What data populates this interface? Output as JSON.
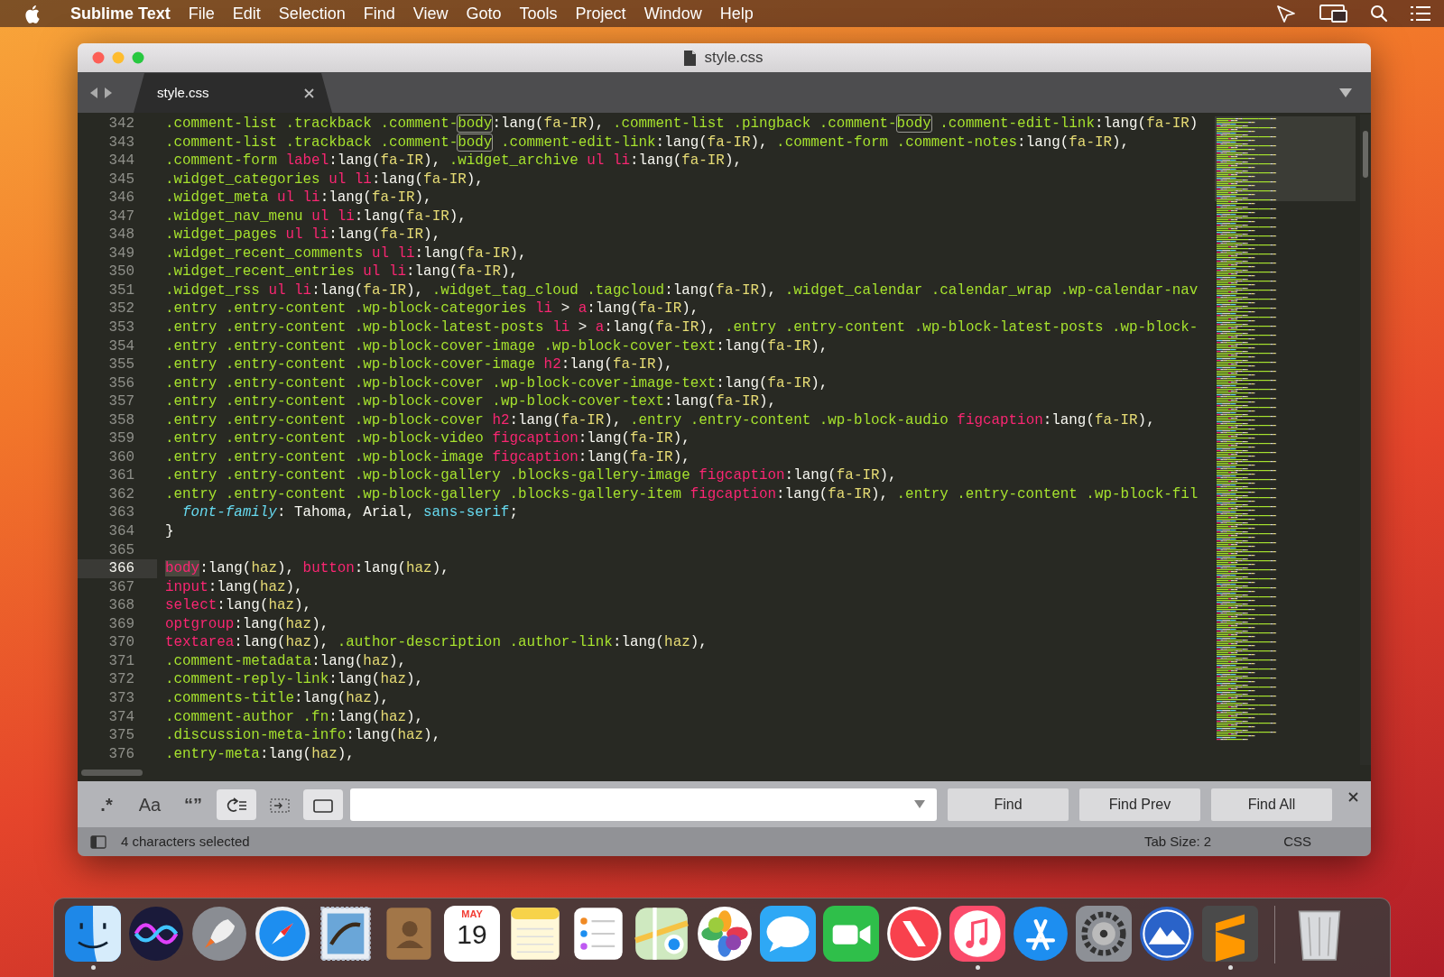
{
  "menu_bar": {
    "app": "Sublime Text",
    "items": [
      "File",
      "Edit",
      "Selection",
      "Find",
      "View",
      "Goto",
      "Tools",
      "Project",
      "Window",
      "Help"
    ]
  },
  "window": {
    "title": "style.css"
  },
  "tabs": [
    {
      "label": "style.css",
      "selected": true
    }
  ],
  "editor": {
    "lines": [
      {
        "number": "342",
        "current": false,
        "tokens": [
          {
            "kind": "selector",
            "text": ".comment-list .trackback .comment-"
          },
          {
            "kind": "match",
            "text": "body"
          },
          {
            "kind": "plain",
            "text": ":lang("
          },
          {
            "kind": "argument",
            "text": "fa-IR"
          },
          {
            "kind": "plain",
            "text": "), "
          },
          {
            "kind": "selector",
            "text": ".comment-list .pingback .comment-"
          },
          {
            "kind": "match",
            "text": "body"
          },
          {
            "kind": "selector",
            "text": " .comment-edit-link"
          },
          {
            "kind": "plain",
            "text": ":lang("
          },
          {
            "kind": "argument",
            "text": "fa-IR"
          },
          {
            "kind": "plain",
            "text": ")"
          }
        ]
      },
      {
        "number": "343",
        "current": false,
        "tokens": [
          {
            "kind": "selector",
            "text": ".comment-list .trackback .comment-"
          },
          {
            "kind": "match",
            "text": "body"
          },
          {
            "kind": "selector",
            "text": " .comment-edit-link"
          },
          {
            "kind": "plain",
            "text": ":lang("
          },
          {
            "kind": "argument",
            "text": "fa-IR"
          },
          {
            "kind": "plain",
            "text": "), "
          },
          {
            "kind": "selector",
            "text": ".comment-form .comment-notes"
          },
          {
            "kind": "plain",
            "text": ":lang("
          },
          {
            "kind": "argument",
            "text": "fa-IR"
          },
          {
            "kind": "plain",
            "text": "),"
          }
        ]
      },
      {
        "number": "344",
        "current": false,
        "tokens": [
          {
            "kind": "selector",
            "text": ".comment-form "
          },
          {
            "kind": "tag",
            "text": "label"
          },
          {
            "kind": "plain",
            "text": ":lang("
          },
          {
            "kind": "argument",
            "text": "fa-IR"
          },
          {
            "kind": "plain",
            "text": "), "
          },
          {
            "kind": "selector",
            "text": ".widget_archive "
          },
          {
            "kind": "tag",
            "text": "ul li"
          },
          {
            "kind": "plain",
            "text": ":lang("
          },
          {
            "kind": "argument",
            "text": "fa-IR"
          },
          {
            "kind": "plain",
            "text": "),"
          }
        ]
      },
      {
        "number": "345",
        "current": false,
        "tokens": [
          {
            "kind": "selector",
            "text": ".widget_categories "
          },
          {
            "kind": "tag",
            "text": "ul li"
          },
          {
            "kind": "plain",
            "text": ":lang("
          },
          {
            "kind": "argument",
            "text": "fa-IR"
          },
          {
            "kind": "plain",
            "text": "),"
          }
        ]
      },
      {
        "number": "346",
        "current": false,
        "tokens": [
          {
            "kind": "selector",
            "text": ".widget_meta "
          },
          {
            "kind": "tag",
            "text": "ul li"
          },
          {
            "kind": "plain",
            "text": ":lang("
          },
          {
            "kind": "argument",
            "text": "fa-IR"
          },
          {
            "kind": "plain",
            "text": "),"
          }
        ]
      },
      {
        "number": "347",
        "current": false,
        "tokens": [
          {
            "kind": "selector",
            "text": ".widget_nav_menu "
          },
          {
            "kind": "tag",
            "text": "ul li"
          },
          {
            "kind": "plain",
            "text": ":lang("
          },
          {
            "kind": "argument",
            "text": "fa-IR"
          },
          {
            "kind": "plain",
            "text": "),"
          }
        ]
      },
      {
        "number": "348",
        "current": false,
        "tokens": [
          {
            "kind": "selector",
            "text": ".widget_pages "
          },
          {
            "kind": "tag",
            "text": "ul li"
          },
          {
            "kind": "plain",
            "text": ":lang("
          },
          {
            "kind": "argument",
            "text": "fa-IR"
          },
          {
            "kind": "plain",
            "text": "),"
          }
        ]
      },
      {
        "number": "349",
        "current": false,
        "tokens": [
          {
            "kind": "selector",
            "text": ".widget_recent_comments "
          },
          {
            "kind": "tag",
            "text": "ul li"
          },
          {
            "kind": "plain",
            "text": ":lang("
          },
          {
            "kind": "argument",
            "text": "fa-IR"
          },
          {
            "kind": "plain",
            "text": "),"
          }
        ]
      },
      {
        "number": "350",
        "current": false,
        "tokens": [
          {
            "kind": "selector",
            "text": ".widget_recent_entries "
          },
          {
            "kind": "tag",
            "text": "ul li"
          },
          {
            "kind": "plain",
            "text": ":lang("
          },
          {
            "kind": "argument",
            "text": "fa-IR"
          },
          {
            "kind": "plain",
            "text": "),"
          }
        ]
      },
      {
        "number": "351",
        "current": false,
        "tokens": [
          {
            "kind": "selector",
            "text": ".widget_rss "
          },
          {
            "kind": "tag",
            "text": "ul li"
          },
          {
            "kind": "plain",
            "text": ":lang("
          },
          {
            "kind": "argument",
            "text": "fa-IR"
          },
          {
            "kind": "plain",
            "text": "), "
          },
          {
            "kind": "selector",
            "text": ".widget_tag_cloud .tagcloud"
          },
          {
            "kind": "plain",
            "text": ":lang("
          },
          {
            "kind": "argument",
            "text": "fa-IR"
          },
          {
            "kind": "plain",
            "text": "), "
          },
          {
            "kind": "selector",
            "text": ".widget_calendar .calendar_wrap .wp-calendar-nav"
          }
        ]
      },
      {
        "number": "352",
        "current": false,
        "tokens": [
          {
            "kind": "selector",
            "text": ".entry .entry-content .wp-block-categories "
          },
          {
            "kind": "tag",
            "text": "li"
          },
          {
            "kind": "plain",
            "text": " > "
          },
          {
            "kind": "tag",
            "text": "a"
          },
          {
            "kind": "plain",
            "text": ":lang("
          },
          {
            "kind": "argument",
            "text": "fa-IR"
          },
          {
            "kind": "plain",
            "text": "),"
          }
        ]
      },
      {
        "number": "353",
        "current": false,
        "tokens": [
          {
            "kind": "selector",
            "text": ".entry .entry-content .wp-block-latest-posts "
          },
          {
            "kind": "tag",
            "text": "li"
          },
          {
            "kind": "plain",
            "text": " > "
          },
          {
            "kind": "tag",
            "text": "a"
          },
          {
            "kind": "plain",
            "text": ":lang("
          },
          {
            "kind": "argument",
            "text": "fa-IR"
          },
          {
            "kind": "plain",
            "text": "), "
          },
          {
            "kind": "selector",
            "text": ".entry .entry-content .wp-block-latest-posts .wp-block-"
          }
        ]
      },
      {
        "number": "354",
        "current": false,
        "tokens": [
          {
            "kind": "selector",
            "text": ".entry .entry-content .wp-block-cover-image .wp-block-cover-text"
          },
          {
            "kind": "plain",
            "text": ":lang("
          },
          {
            "kind": "argument",
            "text": "fa-IR"
          },
          {
            "kind": "plain",
            "text": "),"
          }
        ]
      },
      {
        "number": "355",
        "current": false,
        "tokens": [
          {
            "kind": "selector",
            "text": ".entry .entry-content .wp-block-cover-image "
          },
          {
            "kind": "tag",
            "text": "h2"
          },
          {
            "kind": "plain",
            "text": ":lang("
          },
          {
            "kind": "argument",
            "text": "fa-IR"
          },
          {
            "kind": "plain",
            "text": "),"
          }
        ]
      },
      {
        "number": "356",
        "current": false,
        "tokens": [
          {
            "kind": "selector",
            "text": ".entry .entry-content .wp-block-cover .wp-block-cover-image-text"
          },
          {
            "kind": "plain",
            "text": ":lang("
          },
          {
            "kind": "argument",
            "text": "fa-IR"
          },
          {
            "kind": "plain",
            "text": "),"
          }
        ]
      },
      {
        "number": "357",
        "current": false,
        "tokens": [
          {
            "kind": "selector",
            "text": ".entry .entry-content .wp-block-cover .wp-block-cover-text"
          },
          {
            "kind": "plain",
            "text": ":lang("
          },
          {
            "kind": "argument",
            "text": "fa-IR"
          },
          {
            "kind": "plain",
            "text": "),"
          }
        ]
      },
      {
        "number": "358",
        "current": false,
        "tokens": [
          {
            "kind": "selector",
            "text": ".entry .entry-content .wp-block-cover "
          },
          {
            "kind": "tag",
            "text": "h2"
          },
          {
            "kind": "plain",
            "text": ":lang("
          },
          {
            "kind": "argument",
            "text": "fa-IR"
          },
          {
            "kind": "plain",
            "text": "), "
          },
          {
            "kind": "selector",
            "text": ".entry .entry-content .wp-block-audio "
          },
          {
            "kind": "tag",
            "text": "figcaption"
          },
          {
            "kind": "plain",
            "text": ":lang("
          },
          {
            "kind": "argument",
            "text": "fa-IR"
          },
          {
            "kind": "plain",
            "text": "),"
          }
        ]
      },
      {
        "number": "359",
        "current": false,
        "tokens": [
          {
            "kind": "selector",
            "text": ".entry .entry-content .wp-block-video "
          },
          {
            "kind": "tag",
            "text": "figcaption"
          },
          {
            "kind": "plain",
            "text": ":lang("
          },
          {
            "kind": "argument",
            "text": "fa-IR"
          },
          {
            "kind": "plain",
            "text": "),"
          }
        ]
      },
      {
        "number": "360",
        "current": false,
        "tokens": [
          {
            "kind": "selector",
            "text": ".entry .entry-content .wp-block-image "
          },
          {
            "kind": "tag",
            "text": "figcaption"
          },
          {
            "kind": "plain",
            "text": ":lang("
          },
          {
            "kind": "argument",
            "text": "fa-IR"
          },
          {
            "kind": "plain",
            "text": "),"
          }
        ]
      },
      {
        "number": "361",
        "current": false,
        "tokens": [
          {
            "kind": "selector",
            "text": ".entry .entry-content .wp-block-gallery .blocks-gallery-image "
          },
          {
            "kind": "tag",
            "text": "figcaption"
          },
          {
            "kind": "plain",
            "text": ":lang("
          },
          {
            "kind": "argument",
            "text": "fa-IR"
          },
          {
            "kind": "plain",
            "text": "),"
          }
        ]
      },
      {
        "number": "362",
        "current": false,
        "tokens": [
          {
            "kind": "selector",
            "text": ".entry .entry-content .wp-block-gallery .blocks-gallery-item "
          },
          {
            "kind": "tag",
            "text": "figcaption"
          },
          {
            "kind": "plain",
            "text": ":lang("
          },
          {
            "kind": "argument",
            "text": "fa-IR"
          },
          {
            "kind": "plain",
            "text": "), "
          },
          {
            "kind": "selector",
            "text": ".entry .entry-content .wp-block-fil"
          }
        ]
      },
      {
        "number": "363",
        "current": false,
        "indented": true,
        "tokens": [
          {
            "kind": "property",
            "text": "font-family"
          },
          {
            "kind": "plain",
            "text": ": Tahoma, Arial, "
          },
          {
            "kind": "keyword",
            "text": "sans-serif"
          },
          {
            "kind": "plain",
            "text": ";"
          }
        ]
      },
      {
        "number": "364",
        "current": false,
        "tokens": [
          {
            "kind": "plain",
            "text": "}"
          }
        ]
      },
      {
        "number": "365",
        "current": false
      },
      {
        "number": "366",
        "current": true,
        "tokens": [
          {
            "kind": "selected-tag",
            "text": "body"
          },
          {
            "kind": "plain",
            "text": ":lang("
          },
          {
            "kind": "argument",
            "text": "haz"
          },
          {
            "kind": "plain",
            "text": "), "
          },
          {
            "kind": "tag",
            "text": "button"
          },
          {
            "kind": "plain",
            "text": ":lang("
          },
          {
            "kind": "argument",
            "text": "haz"
          },
          {
            "kind": "plain",
            "text": "),"
          }
        ]
      },
      {
        "number": "367",
        "current": false,
        "tokens": [
          {
            "kind": "tag",
            "text": "input"
          },
          {
            "kind": "plain",
            "text": ":lang("
          },
          {
            "kind": "argument",
            "text": "haz"
          },
          {
            "kind": "plain",
            "text": "),"
          }
        ]
      },
      {
        "number": "368",
        "current": false,
        "tokens": [
          {
            "kind": "tag",
            "text": "select"
          },
          {
            "kind": "plain",
            "text": ":lang("
          },
          {
            "kind": "argument",
            "text": "haz"
          },
          {
            "kind": "plain",
            "text": "),"
          }
        ]
      },
      {
        "number": "369",
        "current": false,
        "tokens": [
          {
            "kind": "tag",
            "text": "optgroup"
          },
          {
            "kind": "plain",
            "text": ":lang("
          },
          {
            "kind": "argument",
            "text": "haz"
          },
          {
            "kind": "plain",
            "text": "),"
          }
        ]
      },
      {
        "number": "370",
        "current": false,
        "tokens": [
          {
            "kind": "tag",
            "text": "textarea"
          },
          {
            "kind": "plain",
            "text": ":lang("
          },
          {
            "kind": "argument",
            "text": "haz"
          },
          {
            "kind": "plain",
            "text": "), "
          },
          {
            "kind": "selector",
            "text": ".author-description .author-link"
          },
          {
            "kind": "plain",
            "text": ":lang("
          },
          {
            "kind": "argument",
            "text": "haz"
          },
          {
            "kind": "plain",
            "text": "),"
          }
        ]
      },
      {
        "number": "371",
        "current": false,
        "tokens": [
          {
            "kind": "selector",
            "text": ".comment-metadata"
          },
          {
            "kind": "plain",
            "text": ":lang("
          },
          {
            "kind": "argument",
            "text": "haz"
          },
          {
            "kind": "plain",
            "text": "),"
          }
        ]
      },
      {
        "number": "372",
        "current": false,
        "tokens": [
          {
            "kind": "selector",
            "text": ".comment-reply-link"
          },
          {
            "kind": "plain",
            "text": ":lang("
          },
          {
            "kind": "argument",
            "text": "haz"
          },
          {
            "kind": "plain",
            "text": "),"
          }
        ]
      },
      {
        "number": "373",
        "current": false,
        "tokens": [
          {
            "kind": "selector",
            "text": ".comments-title"
          },
          {
            "kind": "plain",
            "text": ":lang("
          },
          {
            "kind": "argument",
            "text": "haz"
          },
          {
            "kind": "plain",
            "text": "),"
          }
        ]
      },
      {
        "number": "374",
        "current": false,
        "tokens": [
          {
            "kind": "selector",
            "text": ".comment-author .fn"
          },
          {
            "kind": "plain",
            "text": ":lang("
          },
          {
            "kind": "argument",
            "text": "haz"
          },
          {
            "kind": "plain",
            "text": "),"
          }
        ]
      },
      {
        "number": "375",
        "current": false,
        "tokens": [
          {
            "kind": "selector",
            "text": ".discussion-meta-info"
          },
          {
            "kind": "plain",
            "text": ":lang("
          },
          {
            "kind": "argument",
            "text": "haz"
          },
          {
            "kind": "plain",
            "text": "),"
          }
        ]
      },
      {
        "number": "376",
        "current": false,
        "tokens": [
          {
            "kind": "selector",
            "text": ".entry-meta"
          },
          {
            "kind": "plain",
            "text": ":lang("
          },
          {
            "kind": "argument",
            "text": "haz"
          },
          {
            "kind": "plain",
            "text": "),"
          }
        ]
      }
    ]
  },
  "find_panel": {
    "toggles": [
      {
        "kind": "regex",
        "label": ".*",
        "on": false
      },
      {
        "kind": "case",
        "label": "Aa",
        "on": false
      },
      {
        "kind": "word",
        "label": "“”",
        "on": false
      },
      {
        "kind": "wrap",
        "on": true
      },
      {
        "kind": "in-selection",
        "on": false
      },
      {
        "kind": "highlight",
        "on": true
      }
    ],
    "buttons": [
      "Find",
      "Find Prev",
      "Find All"
    ]
  },
  "status_bar": {
    "selection": "4 characters selected",
    "tab_size": "Tab Size: 2",
    "syntax": "CSS"
  },
  "dock": {
    "items": [
      {
        "kind": "finder",
        "running": true
      },
      {
        "kind": "siri",
        "running": false
      },
      {
        "kind": "launchpad",
        "running": false
      },
      {
        "kind": "safari",
        "running": false
      },
      {
        "kind": "mail",
        "running": false
      },
      {
        "kind": "contacts",
        "running": false
      },
      {
        "kind": "calendar",
        "month": "MAY",
        "day": "19",
        "running": false
      },
      {
        "kind": "notes",
        "running": false
      },
      {
        "kind": "reminders",
        "running": false
      },
      {
        "kind": "maps",
        "running": false
      },
      {
        "kind": "photos",
        "running": false
      },
      {
        "kind": "messages",
        "running": false
      },
      {
        "kind": "facetime",
        "running": false
      },
      {
        "kind": "news",
        "running": false
      },
      {
        "kind": "music",
        "running": true
      },
      {
        "kind": "appstore",
        "running": false
      },
      {
        "kind": "settings",
        "running": false
      },
      {
        "kind": "peaks",
        "running": false
      },
      {
        "kind": "editor",
        "running": true
      },
      {
        "kind": "trash",
        "running": false
      }
    ]
  }
}
